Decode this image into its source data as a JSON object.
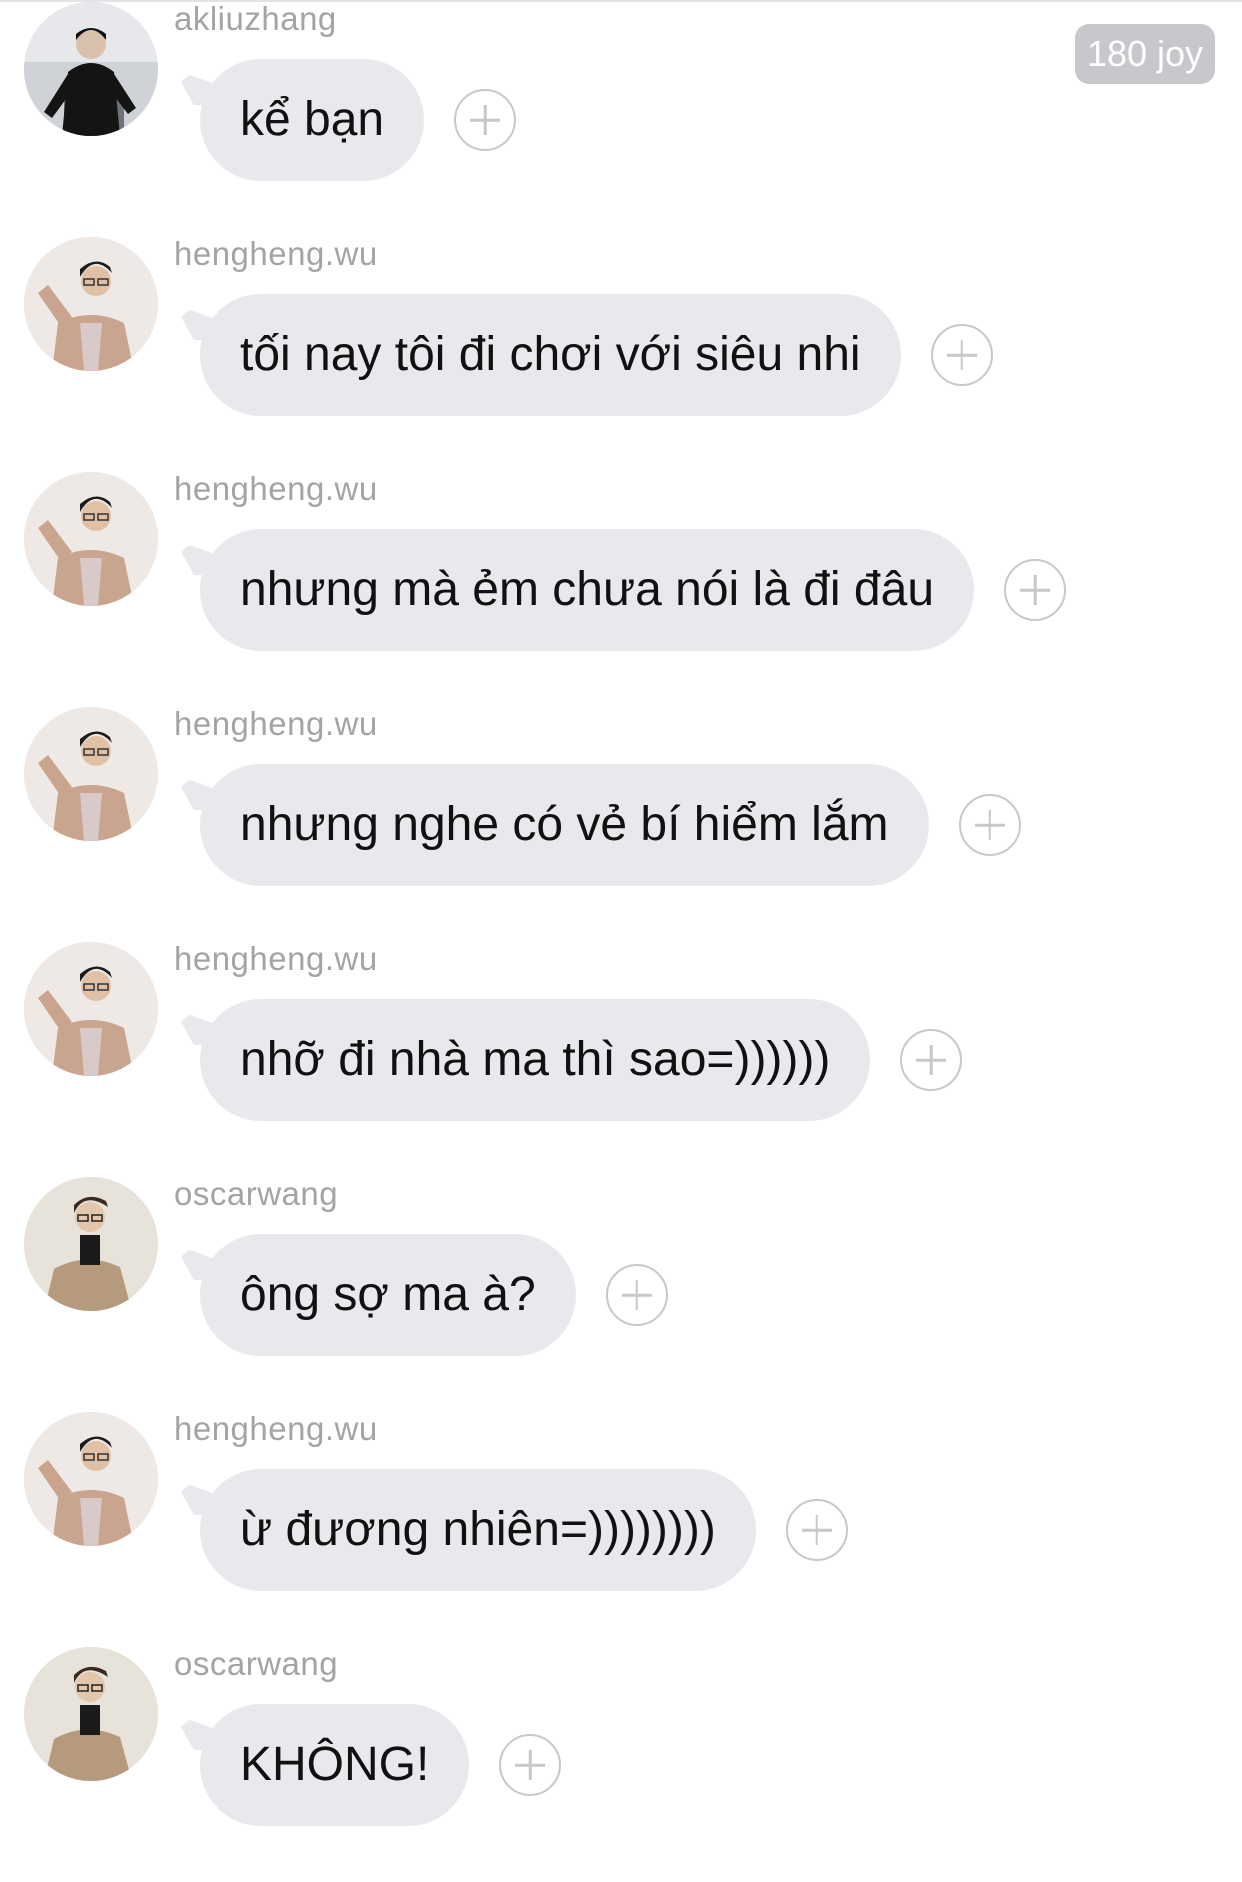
{
  "badge": {
    "text": "180 joy"
  },
  "colors": {
    "bubble": "#e8e9ec",
    "username": "#a4a4a8",
    "badge_bg": "#c8c8cc",
    "plus": "#c7c7cc"
  },
  "messages": [
    {
      "user": "akliuzhang",
      "text": "kể bạn",
      "avatar": "akliuzhang"
    },
    {
      "user": "hengheng.wu",
      "text": "tối nay tôi đi chơi với siêu nhi",
      "avatar": "hengheng"
    },
    {
      "user": "hengheng.wu",
      "text": "nhưng mà ẻm chưa nói là đi đâu",
      "avatar": "hengheng"
    },
    {
      "user": "hengheng.wu",
      "text": "nhưng nghe có vẻ bí hiểm lắm",
      "avatar": "hengheng"
    },
    {
      "user": "hengheng.wu",
      "text": "nhỡ đi nhà ma thì sao=))))))",
      "avatar": "hengheng"
    },
    {
      "user": "oscarwang",
      "text": "ông sợ ma à?",
      "avatar": "oscar"
    },
    {
      "user": "hengheng.wu",
      "text": "ừ đương nhiên=))))))))",
      "avatar": "hengheng"
    },
    {
      "user": "oscarwang",
      "text": "KHÔNG!",
      "avatar": "oscar"
    }
  ]
}
